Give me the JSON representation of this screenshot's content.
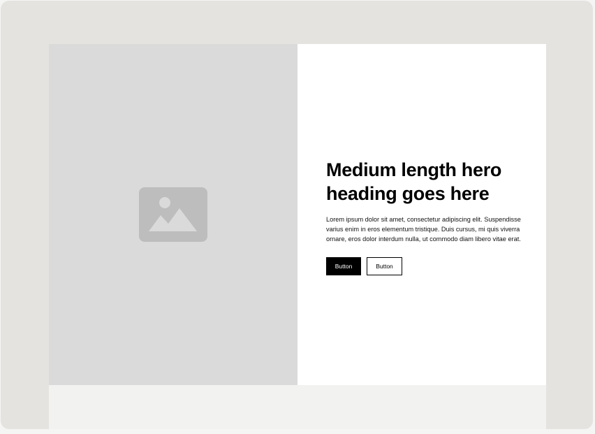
{
  "hero": {
    "heading": "Medium length hero heading goes here",
    "paragraph": "Lorem ipsum dolor sit amet, consectetur adipiscing elit. Suspendisse varius enim in eros elementum tristique. Duis cursus, mi quis viverra ornare, eros dolor interdum nulla, ut commodo diam libero vitae erat.",
    "primary_button_label": "Button",
    "secondary_button_label": "Button",
    "image_icon": "image-placeholder-icon"
  },
  "colors": {
    "frame": "#e4e3df",
    "image_placeholder": "#dadada",
    "icon": "#bdbdbd",
    "primary_button": "#000000",
    "content_background": "#ffffff"
  }
}
